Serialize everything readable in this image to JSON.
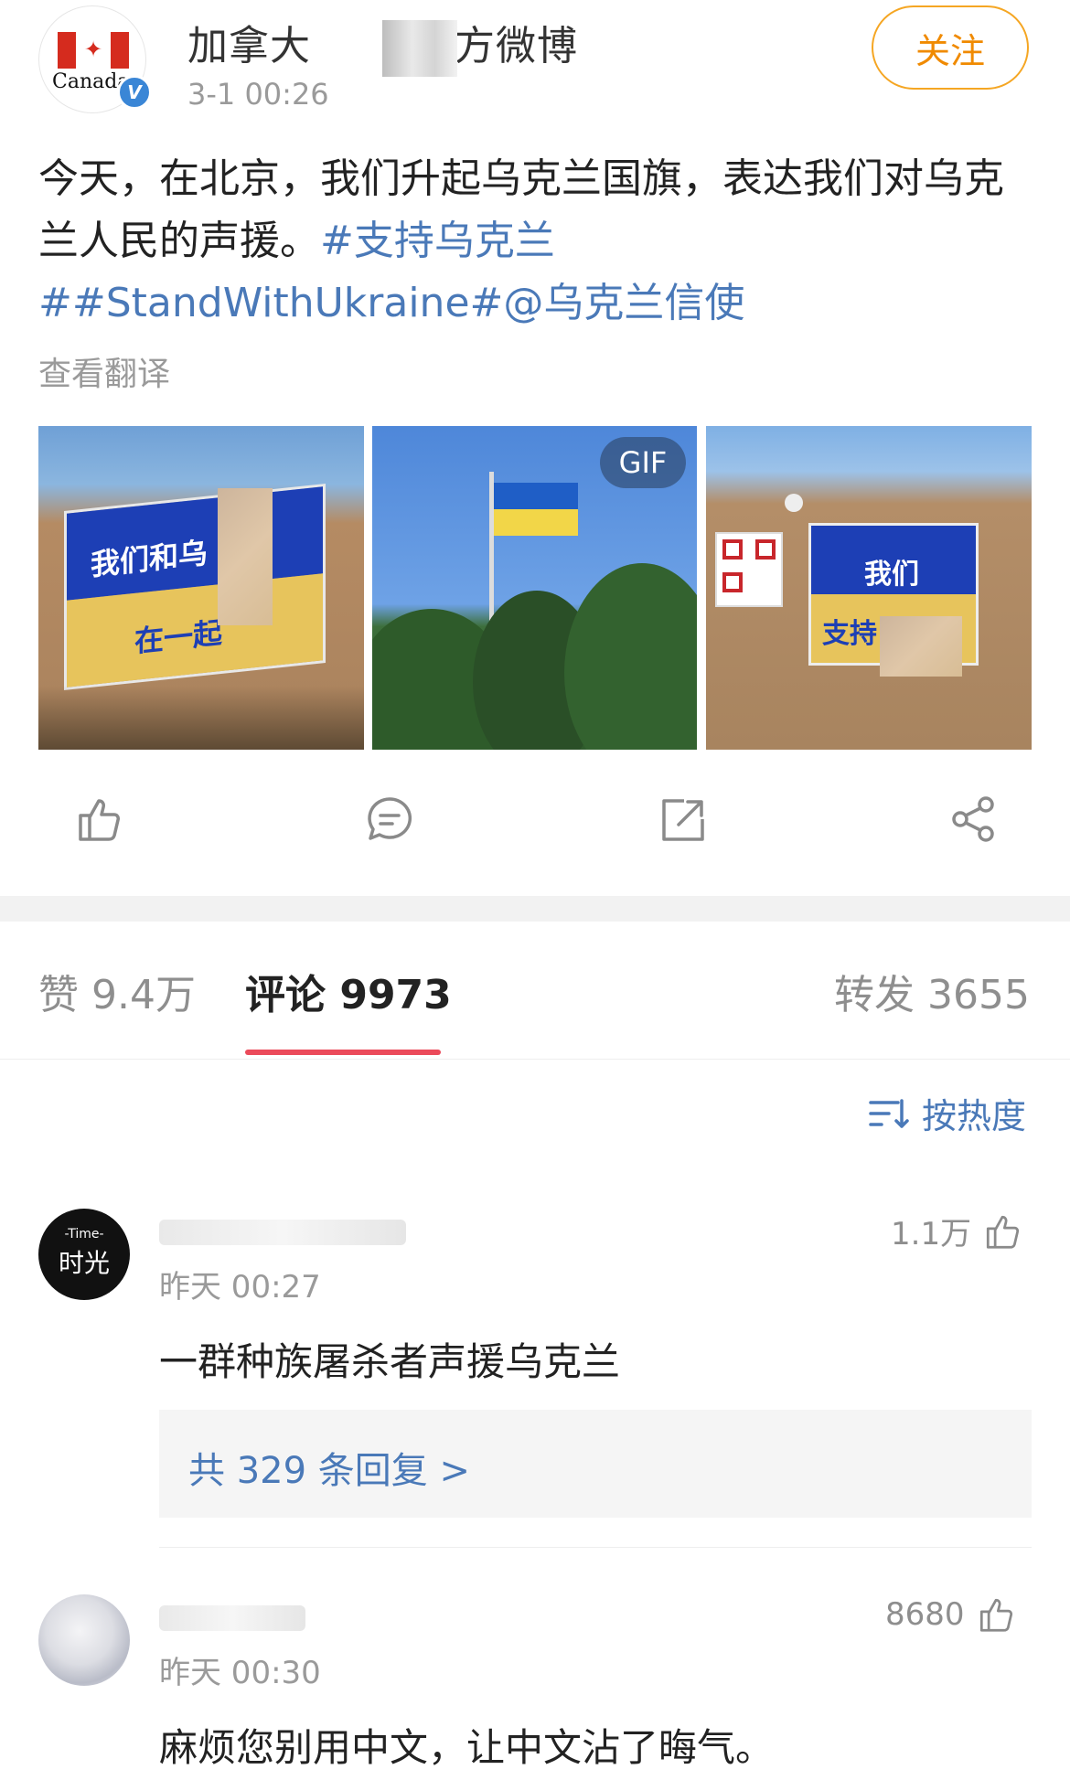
{
  "post": {
    "author_name_left": "加拿大",
    "author_name_right": "官方微博",
    "time": "3-1 00:26",
    "follow_label": "关注",
    "avatar_caption": "Canada",
    "verified_mark": "V",
    "text_main": "今天，在北京，我们升起乌克兰国旗，表达我们对乌克兰人民的声援。",
    "hashtag_1": "#支持乌克兰",
    "hashtag_2": "##StandWithUkraine#",
    "mention": "@乌克兰信使",
    "translate_label": "查看翻译",
    "images": [
      {
        "sign_top": "我们和乌",
        "sign_bottom": "在一起"
      },
      {
        "badge": "GIF"
      },
      {
        "sign_top": "我们",
        "sign_bottom": "支持"
      }
    ]
  },
  "actions": [
    "like-icon",
    "comment-icon",
    "repost-icon",
    "share-icon"
  ],
  "tabs": {
    "likes_label": "赞",
    "likes_value": "9.4万",
    "comments_label": "评论",
    "comments_value": "9973",
    "reposts_label": "转发",
    "reposts_value": "3655"
  },
  "sort_label": "按热度",
  "comments": [
    {
      "avatar_text_top": "-Time-",
      "avatar_text_main": "时光",
      "time": "昨天 00:27",
      "likes": "1.1万",
      "text": "一群种族屠杀者声援乌克兰",
      "replies_label": "共 329 条回复 >"
    },
    {
      "time": "昨天 00:30",
      "likes": "8680",
      "text": "麻烦您别用中文，让中文沾了晦气。"
    }
  ],
  "colors": {
    "link": "#4a79b8",
    "follow": "#f08a00",
    "tab_underline": "#eb4a5a",
    "verified": "#3a86d6"
  }
}
